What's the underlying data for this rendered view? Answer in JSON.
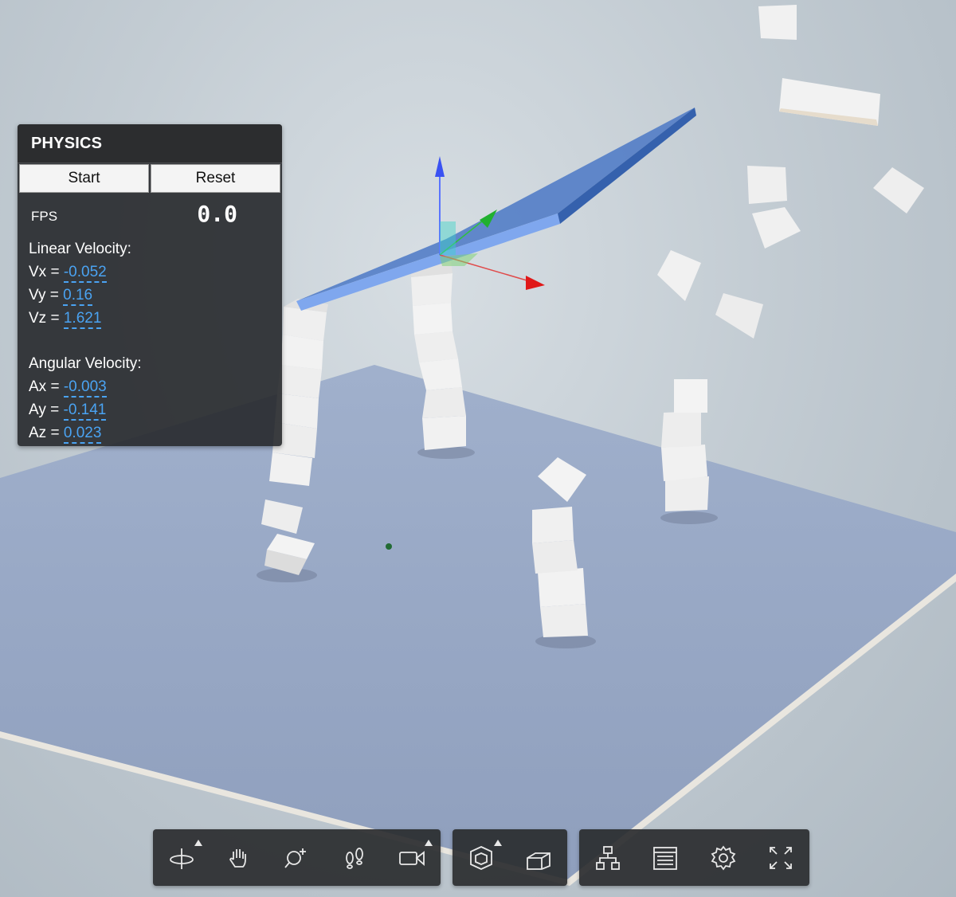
{
  "panel": {
    "title": "PHYSICS",
    "start_label": "Start",
    "reset_label": "Reset",
    "fps_label": "FPS",
    "fps_value": "0.0",
    "linear_heading": "Linear Velocity:",
    "angular_heading": "Angular Velocity:",
    "linear": [
      {
        "label": "Vx =",
        "value": "-0.052"
      },
      {
        "label": "Vy =",
        "value": "0.16"
      },
      {
        "label": "Vz =",
        "value": "1.621"
      }
    ],
    "angular": [
      {
        "label": "Ax =",
        "value": "-0.003"
      },
      {
        "label": "Ay =",
        "value": "-0.141"
      },
      {
        "label": "Az =",
        "value": "0.023"
      }
    ]
  },
  "toolbar": {
    "navigation": [
      "orbit-icon",
      "pan-hand-icon",
      "zoom-icon",
      "first-person-footsteps-icon",
      "camera-icon"
    ],
    "model": [
      "explode-model-icon",
      "section-box-icon"
    ],
    "settings": [
      "model-browser-icon",
      "properties-icon",
      "gear-icon",
      "fullscreen-icon"
    ]
  },
  "colors": {
    "accent_value": "#4aa3f2",
    "panel_bg": "#26282b",
    "selected_plane": "#5b86cf",
    "ground_plane": "#96a7c6"
  }
}
